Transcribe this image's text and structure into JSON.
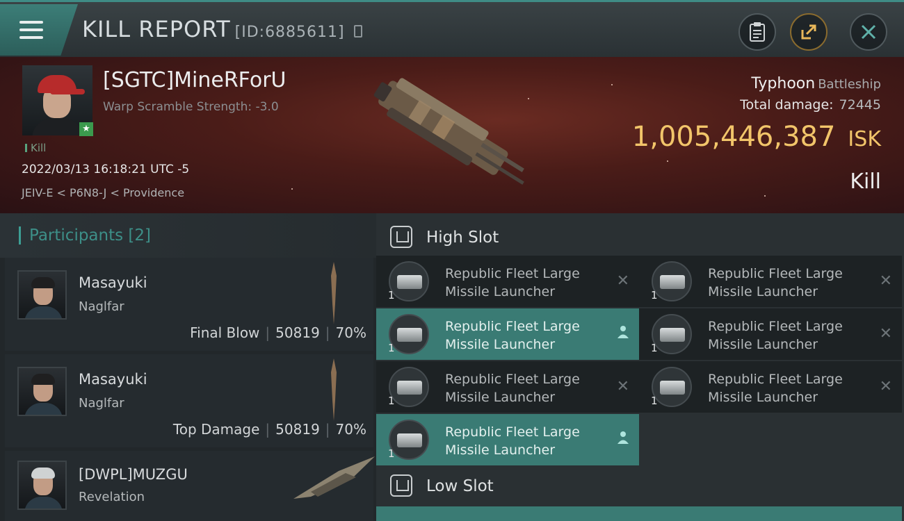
{
  "header": {
    "title": "KILL REPORT",
    "kill_id": "[ID:6885611]",
    "buttons": [
      "clipboard-icon",
      "share-icon",
      "close-icon"
    ]
  },
  "victim": {
    "name": "[SGTC]MineRForU",
    "subtitle": "Warp Scramble Strength: -3.0",
    "tag": "Kill",
    "timestamp": "2022/03/13 16:18:21 UTC -5",
    "location": "JEIV-E < P6N8-J < Providence",
    "ship": "Typhoon",
    "ship_class": "Battleship",
    "damage_label": "Total damage:",
    "damage_value": "72445",
    "isk_value": "1,005,446,387",
    "isk_unit": "ISK",
    "result": "Kill"
  },
  "participants": {
    "title": "Participants",
    "count": "[2]",
    "rows": [
      {
        "name": "Masayuki",
        "ship": "Naglfar",
        "role": "Final Blow",
        "damage": "50819",
        "percent": "70%"
      },
      {
        "name": "Masayuki",
        "ship": "Naglfar",
        "role": "Top Damage",
        "damage": "50819",
        "percent": "70%"
      },
      {
        "name": "[DWPL]MUZGU",
        "ship": "Revelation"
      }
    ]
  },
  "fittings": {
    "high_slot_label": "High Slot",
    "low_slot_label": "Low Slot",
    "high_slot_items": [
      {
        "name": "Republic Fleet Large Missile Launcher",
        "qty": "1",
        "status": "destroyed"
      },
      {
        "name": "Republic Fleet Large Missile Launcher",
        "qty": "1",
        "status": "destroyed"
      },
      {
        "name": "Republic Fleet Large Missile Launcher",
        "qty": "1",
        "status": "dropped"
      },
      {
        "name": "Republic Fleet Large Missile Launcher",
        "qty": "1",
        "status": "destroyed"
      },
      {
        "name": "Republic Fleet Large Missile Launcher",
        "qty": "1",
        "status": "destroyed"
      },
      {
        "name": "Republic Fleet Large Missile Launcher",
        "qty": "1",
        "status": "destroyed"
      },
      {
        "name": "Republic Fleet Large Missile Launcher",
        "qty": "1",
        "status": "dropped"
      }
    ]
  },
  "colors": {
    "accent_teal": "#3d8f88",
    "isk_gold": "#f2c56a",
    "dropped_bg": "#3a7b74"
  }
}
